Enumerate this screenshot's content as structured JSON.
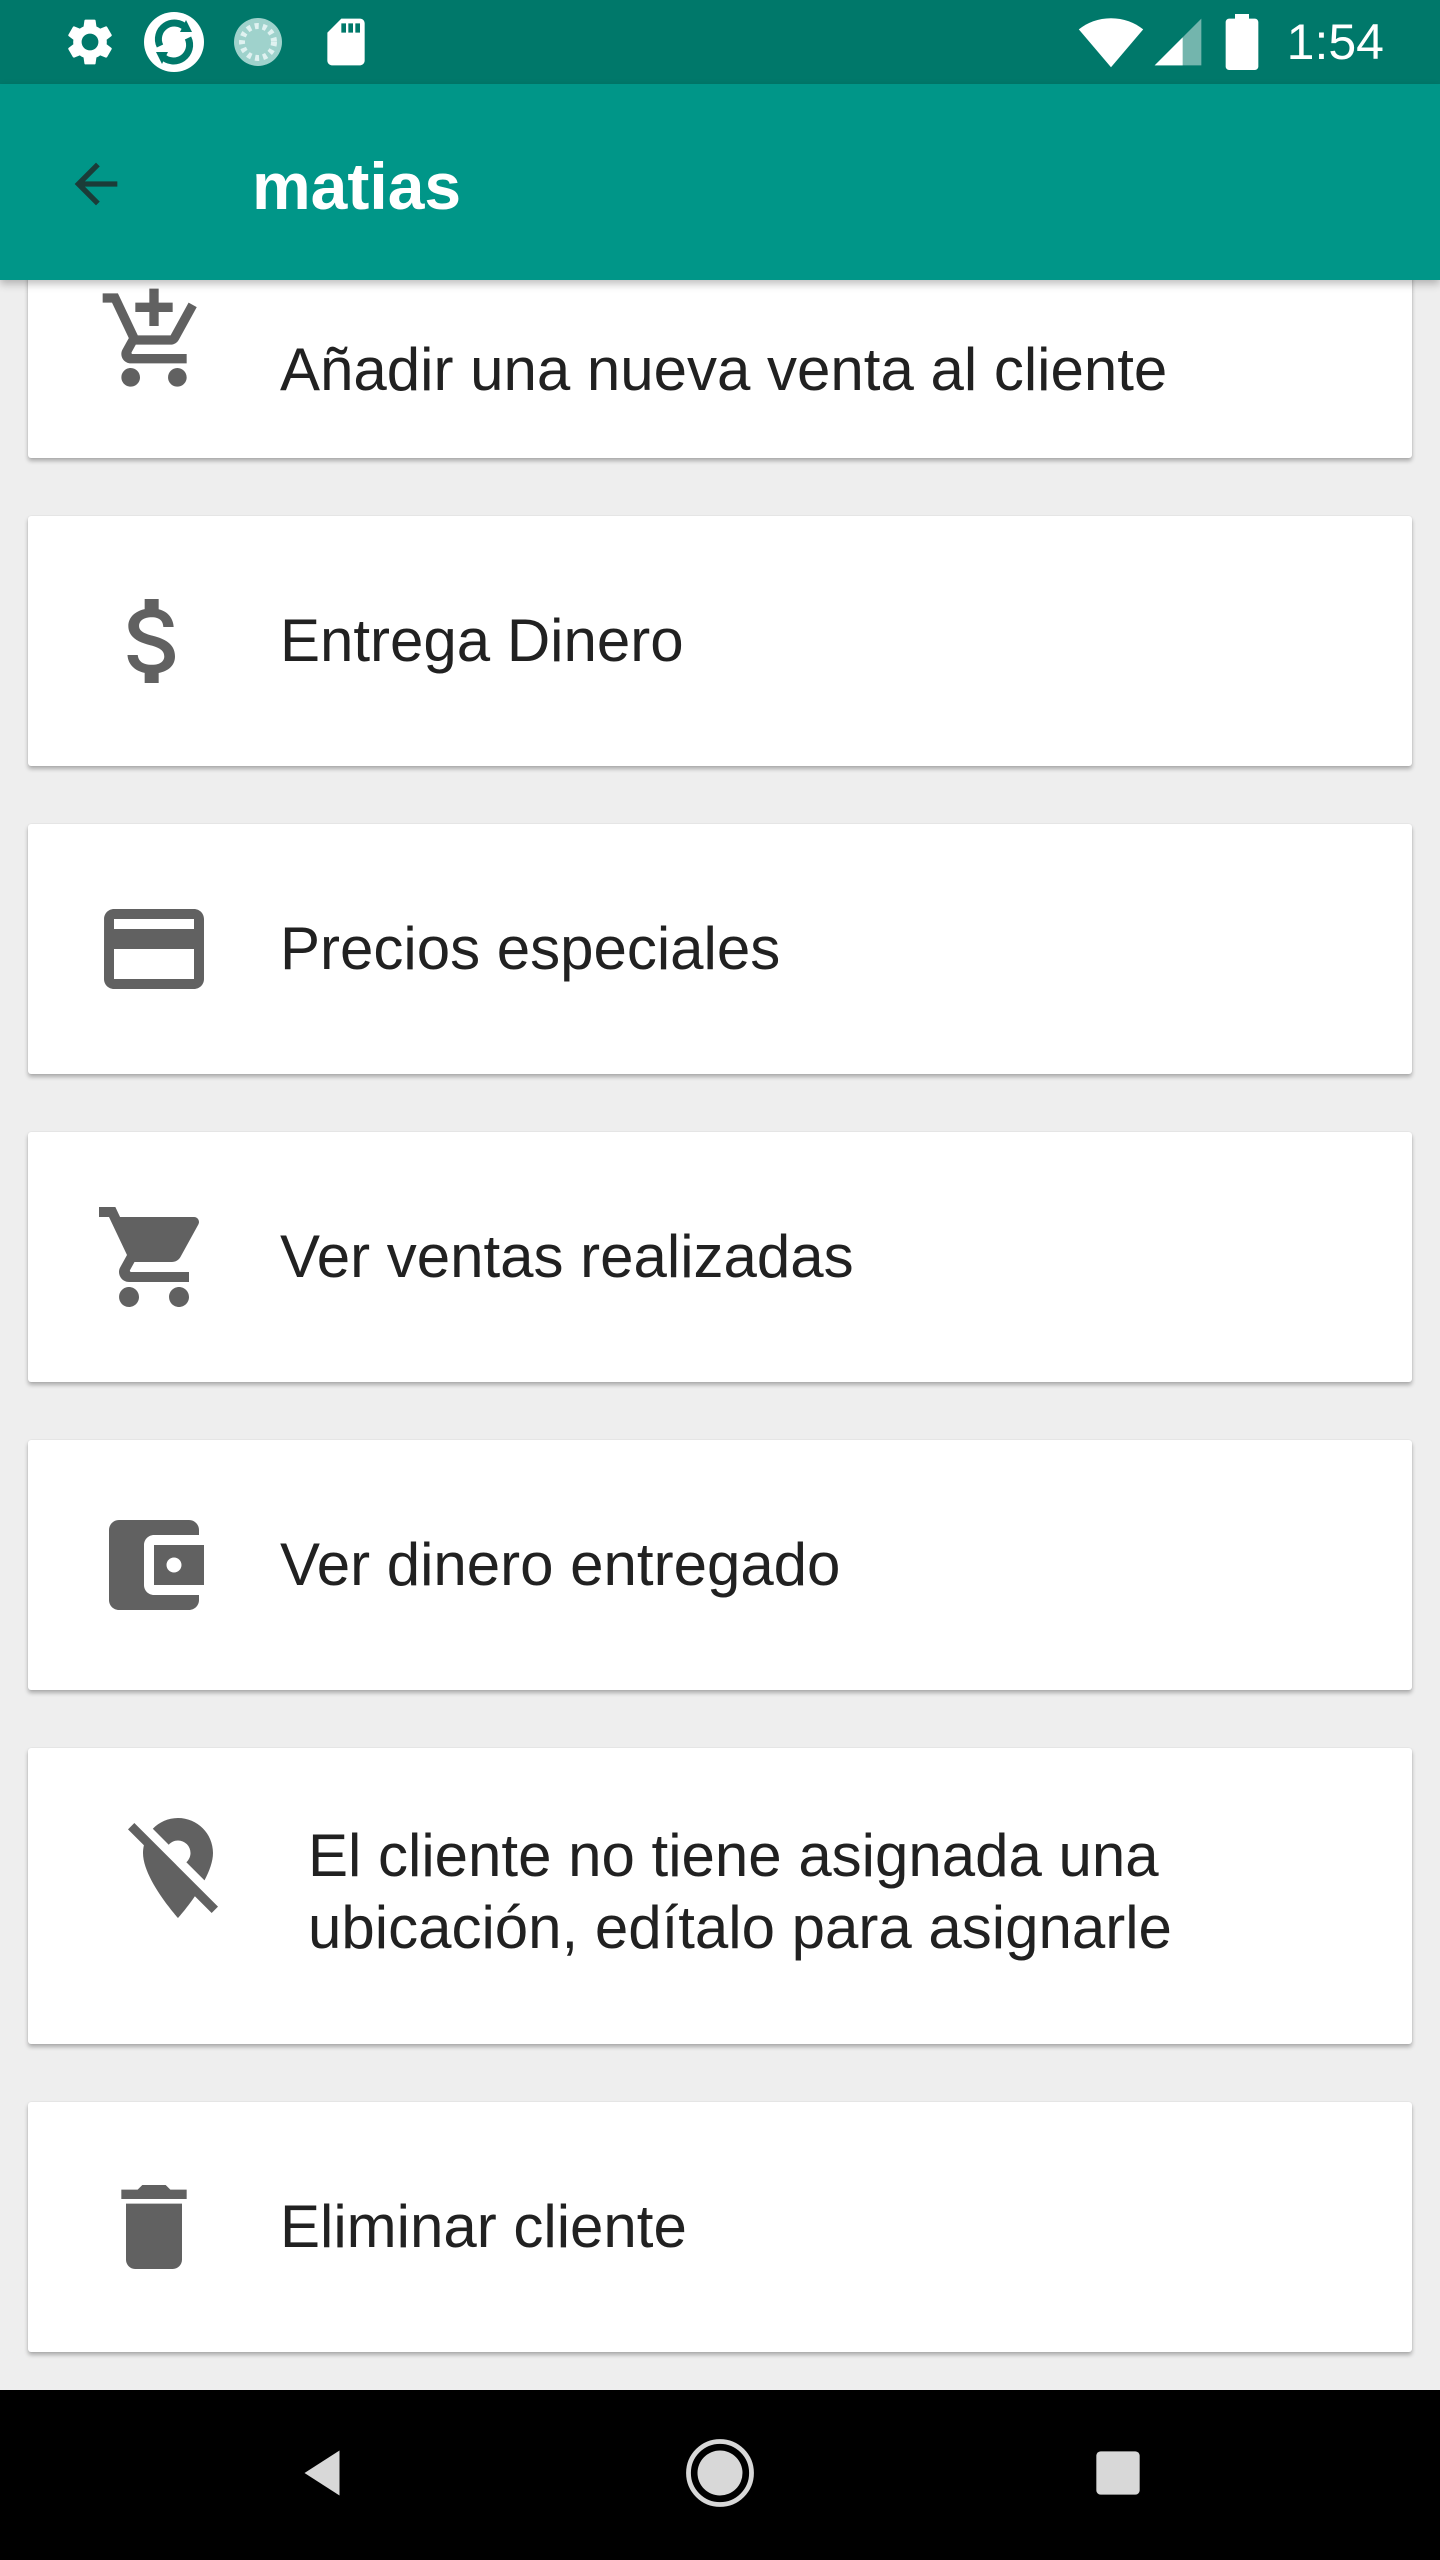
{
  "status_bar": {
    "time": "1:54",
    "icons": [
      "settings-icon",
      "sync-app-icon",
      "loading-app-icon",
      "sd-card-icon",
      "wifi-icon",
      "signal-icon",
      "battery-icon"
    ]
  },
  "app_bar": {
    "title": "matias",
    "back_icon": "arrow-back-icon"
  },
  "actions": [
    {
      "icon": "add-shopping-cart-icon",
      "label": "Añadir una nueva venta al cliente"
    },
    {
      "icon": "dollar-icon",
      "label": "Entrega Dinero"
    },
    {
      "icon": "credit-card-icon",
      "label": "Precios especiales"
    },
    {
      "icon": "shopping-cart-icon",
      "label": "Ver ventas realizadas"
    },
    {
      "icon": "wallet-icon",
      "label": "Ver dinero entregado"
    },
    {
      "icon": "location-off-icon",
      "label_line1": "El cliente no tiene asignada una",
      "label_line2": "ubicación, edítalo para asignarle"
    },
    {
      "icon": "trash-icon",
      "label": "Eliminar cliente"
    }
  ],
  "nav_bar": {
    "icons": [
      "nav-back-icon",
      "nav-home-icon",
      "nav-recents-icon"
    ]
  },
  "colors": {
    "status_bar": "#00786a",
    "app_bar": "#009688",
    "background": "#eeeeee",
    "card": "#ffffff",
    "icon": "#616161",
    "text": "#212121",
    "nav_bar": "#000000"
  }
}
